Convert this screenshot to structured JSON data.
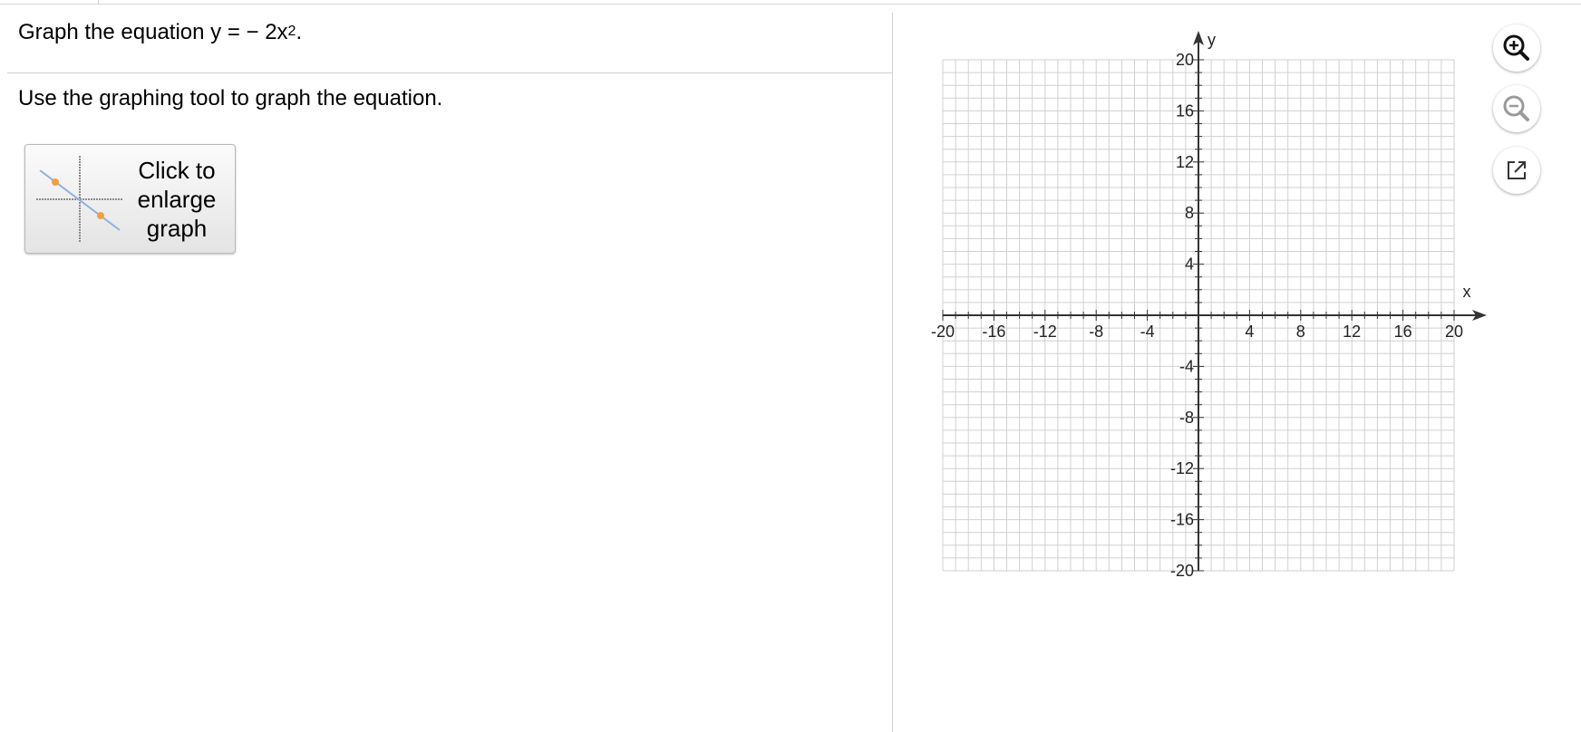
{
  "question": {
    "prefix": "Graph the equation y = − 2x",
    "exponent": "2",
    "suffix": "."
  },
  "instruction": "Use the graphing tool to graph the equation.",
  "enlarge_button": {
    "label": "Click to\nenlarge\ngraph"
  },
  "graph": {
    "x_axis_label": "x",
    "y_axis_label": "y",
    "x_range": [
      -20,
      20
    ],
    "y_range": [
      -20,
      20
    ],
    "minor_grid_step": 1,
    "label_step": 4,
    "x_tick_labels": [
      "-20",
      "-16",
      "-12",
      "-8",
      "-4",
      "4",
      "8",
      "12",
      "16",
      "20"
    ],
    "y_tick_labels": [
      "20",
      "16",
      "12",
      "8",
      "4",
      "-4",
      "-8",
      "-12",
      "-16",
      "-20"
    ],
    "grid": true
  },
  "toolbar": {
    "zoom_in_icon": "zoom-in-icon",
    "zoom_out_icon": "zoom-out-icon",
    "popout_icon": "popout-icon"
  },
  "colors": {
    "grid_line": "#d0d0d0",
    "axis": "#333333",
    "zoom_out_icon": "#9a9a9a",
    "thumb_line": "#8fb0e0",
    "thumb_point": "#f0a040"
  }
}
